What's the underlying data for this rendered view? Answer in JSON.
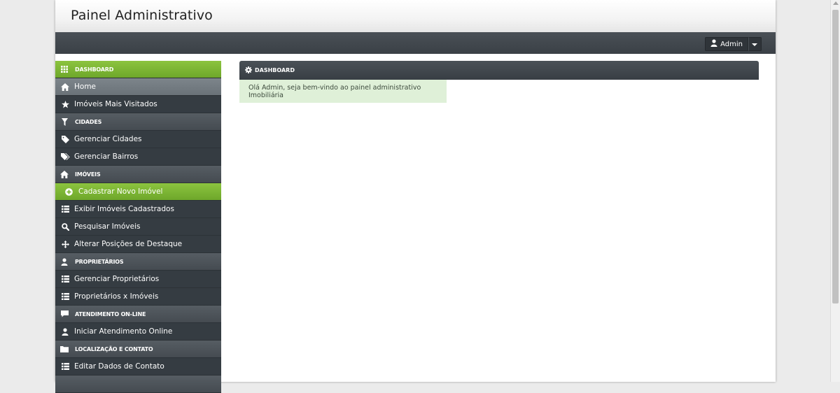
{
  "header": {
    "title": "Painel Administrativo"
  },
  "navbar": {
    "user_label": "Admin"
  },
  "sidebar": {
    "items": [
      {
        "label": "DASHBOARD",
        "icon": "grid-icon",
        "kind": "cat-green"
      },
      {
        "label": "Home",
        "icon": "home-icon",
        "kind": "selected"
      },
      {
        "label": "Imóveis Mais Visitados",
        "icon": "star-icon",
        "kind": "item"
      },
      {
        "label": "CIDADES",
        "icon": "filter-icon",
        "kind": "cat"
      },
      {
        "label": "Gerenciar Cidades",
        "icon": "tag-icon",
        "kind": "item"
      },
      {
        "label": "Gerenciar Bairros",
        "icon": "tags-icon",
        "kind": "item"
      },
      {
        "label": "IMÓVEIS",
        "icon": "home-icon",
        "kind": "cat"
      },
      {
        "label": "Cadastrar Novo Imóvel",
        "icon": "plus-circle-icon",
        "kind": "green-sub"
      },
      {
        "label": "Exibir Imóveis Cadastrados",
        "icon": "list-icon",
        "kind": "item"
      },
      {
        "label": "Pesquisar Imóveis",
        "icon": "search-icon",
        "kind": "item"
      },
      {
        "label": "Alterar Posições de Destaque",
        "icon": "move-icon",
        "kind": "item"
      },
      {
        "label": "PROPRIETÁRIOS",
        "icon": "user-icon",
        "kind": "cat"
      },
      {
        "label": "Gerenciar Proprietários",
        "icon": "list-icon",
        "kind": "item"
      },
      {
        "label": "Proprietários x Imóveis",
        "icon": "list-icon",
        "kind": "item"
      },
      {
        "label": "ATENDIMENTO ON-LINE",
        "icon": "comment-icon",
        "kind": "cat"
      },
      {
        "label": "Iniciar Atendimento Online",
        "icon": "user-icon",
        "kind": "item"
      },
      {
        "label": "LOCALIZAÇÃO E CONTATO",
        "icon": "folder-icon",
        "kind": "cat"
      },
      {
        "label": "Editar Dados de Contato",
        "icon": "list-icon",
        "kind": "item"
      }
    ]
  },
  "main": {
    "panel_title": "DASHBOARD",
    "welcome_message": "Olá Admin, seja bem-vindo ao painel administrativo Imobiliária"
  }
}
